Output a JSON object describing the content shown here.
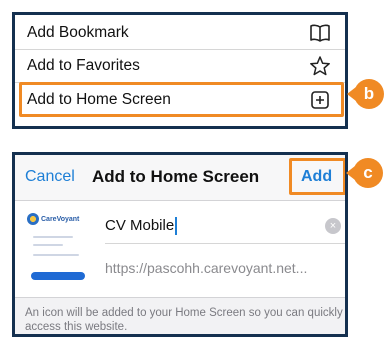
{
  "share_menu": {
    "items": [
      {
        "label": "Add Bookmark",
        "icon": "book-icon"
      },
      {
        "label": "Add to Favorites",
        "icon": "star-icon"
      },
      {
        "label": "Add to Home Screen",
        "icon": "plus-square-icon"
      }
    ]
  },
  "callouts": {
    "b": "b",
    "c": "c",
    "color": "#f08a24"
  },
  "add_to_home": {
    "cancel_label": "Cancel",
    "title": "Add to Home Screen",
    "add_label": "Add",
    "app_thumbnail": {
      "logo_text": "CareVoyant"
    },
    "name_value": "CV Mobile",
    "url": "https://pascohh.carevoyant.net...",
    "note": "An icon will be added to your Home Screen so you can quickly access this website."
  },
  "colors": {
    "accent": "#1e7fd6",
    "frame": "#14304f",
    "highlight": "#f08a24"
  }
}
